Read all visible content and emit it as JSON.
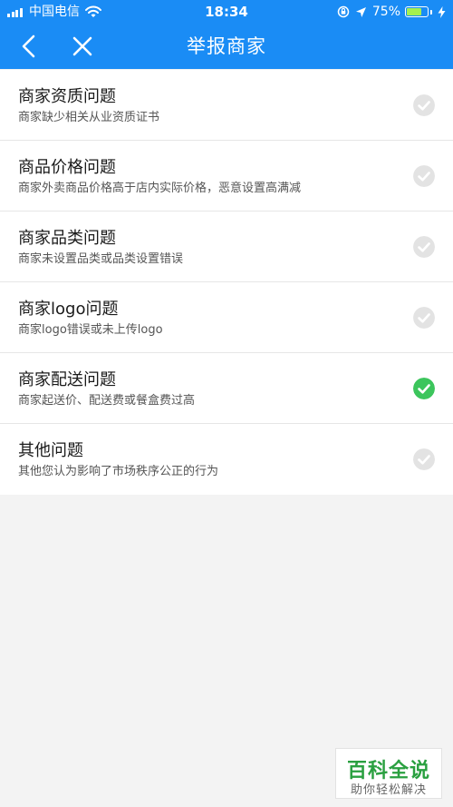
{
  "status_bar": {
    "carrier": "中国电信",
    "time": "18:34",
    "battery": "75%",
    "battery_level": 0.75,
    "icons": [
      "signal-icon",
      "wifi-icon",
      "orientation-lock-icon",
      "location-icon",
      "battery-icon",
      "charging-icon"
    ]
  },
  "nav": {
    "title": "举报商家",
    "back_icon": "chevron-left-icon",
    "close_icon": "close-icon"
  },
  "items": [
    {
      "title": "商家资质问题",
      "desc": "商家缺少相关从业资质证书",
      "selected": false
    },
    {
      "title": "商品价格问题",
      "desc": "商家外卖商品价格高于店内实际价格，恶意设置高满减",
      "selected": false
    },
    {
      "title": "商家品类问题",
      "desc": "商家未设置品类或品类设置错误",
      "selected": false
    },
    {
      "title": "商家logo问题",
      "desc": "商家logo错误或未上传logo",
      "selected": false
    },
    {
      "title": "商家配送问题",
      "desc": "商家起送价、配送费或餐盒费过高",
      "selected": true
    },
    {
      "title": "其他问题",
      "desc": "其他您认为影响了市场秩序公正的行为",
      "selected": false
    }
  ],
  "colors": {
    "header": "#1a8cf5",
    "check_selected": "#3cc55c",
    "check_unselected": "#e3e3e3"
  },
  "watermark": {
    "title": "百科全说",
    "subtitle": "助你轻松解决"
  }
}
